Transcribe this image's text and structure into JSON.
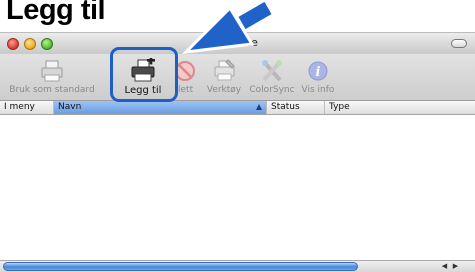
{
  "caption": "Legg til",
  "window": {
    "title": "verliste"
  },
  "toolbar": {
    "items": [
      {
        "label": "Bruk som standard",
        "icon": "printer-icon"
      },
      {
        "label": "Legg til",
        "icon": "add-printer-icon"
      },
      {
        "label": "lett",
        "icon": "delete-icon"
      },
      {
        "label": "Verktøy",
        "icon": "utility-icon"
      },
      {
        "label": "ColorSync",
        "icon": "colorsync-icon"
      },
      {
        "label": "Vis info",
        "icon": "info-icon"
      }
    ]
  },
  "table": {
    "columns": [
      "I meny",
      "Navn",
      "Status",
      "Type"
    ]
  },
  "colors": {
    "highlight": "#1e5fc6",
    "arrow": "#1f63c9"
  }
}
